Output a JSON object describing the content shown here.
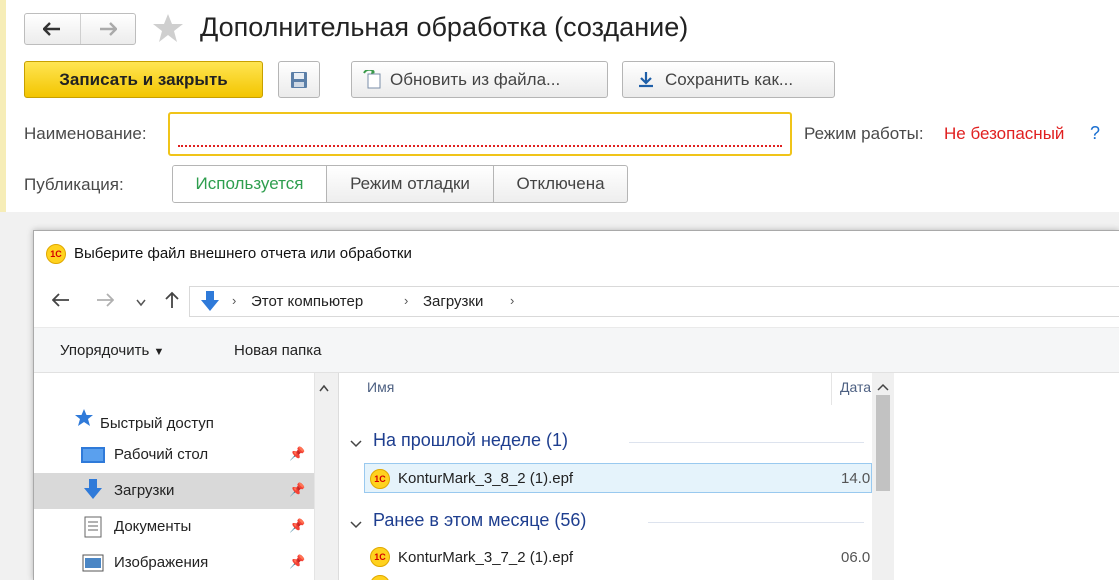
{
  "window": {
    "title": "Дополнительная обработка (создание)"
  },
  "toolbar": {
    "save_close": "Записать и закрыть",
    "update_from_file": "Обновить из файла...",
    "save_as": "Сохранить как..."
  },
  "form": {
    "name_label": "Наименование:",
    "name_value": "",
    "mode_label": "Режим работы:",
    "mode_value": "Не безопасный",
    "help_mark": "?",
    "publication_label": "Публикация:",
    "publication_options": [
      "Используется",
      "Режим отладки",
      "Отключена"
    ],
    "publication_selected": "Используется"
  },
  "dialog": {
    "title": "Выберите файл внешнего отчета или обработки",
    "breadcrumb": [
      "Этот компьютер",
      "Загрузки"
    ],
    "toolbar": {
      "organize": "Упорядочить",
      "new_folder": "Новая папка"
    },
    "nav": {
      "quick_access": "Быстрый доступ",
      "items": [
        {
          "label": "Рабочий стол",
          "icon": "desktop-icon",
          "selected": false
        },
        {
          "label": "Загрузки",
          "icon": "downloads-icon",
          "selected": true
        },
        {
          "label": "Документы",
          "icon": "documents-icon",
          "selected": false
        },
        {
          "label": "Изображения",
          "icon": "pictures-icon",
          "selected": false
        }
      ]
    },
    "columns": {
      "name": "Имя",
      "date": "Дата"
    },
    "groups": [
      {
        "label": "На прошлой неделе (1)",
        "files": [
          {
            "name": "KonturMark_3_8_2 (1).epf",
            "date": "14.0",
            "selected": true
          }
        ]
      },
      {
        "label": "Ранее в этом месяце (56)",
        "files": [
          {
            "name": "KonturMark_3_7_2 (1).epf",
            "date": "06.0",
            "selected": false
          }
        ]
      }
    ]
  },
  "colors": {
    "accent_yellow": "#f3c500",
    "error_red": "#e02020",
    "used_green": "#2e9e4e",
    "help_blue": "#1a6fd1",
    "group_blue": "#1e3e8f"
  }
}
